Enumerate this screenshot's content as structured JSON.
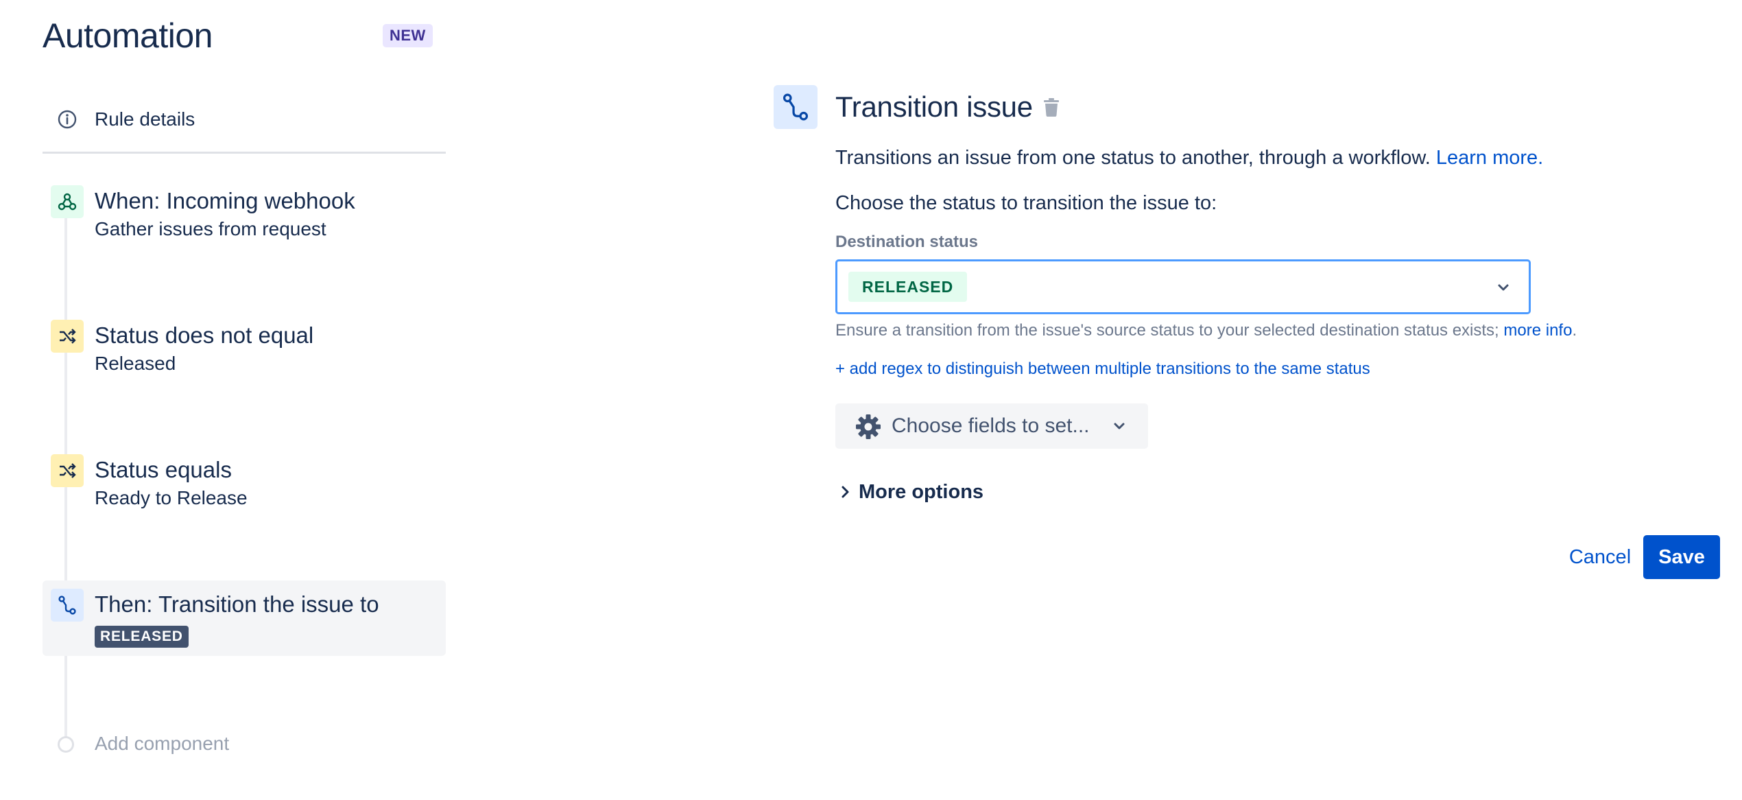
{
  "app": {
    "title": "Automation",
    "badge": "NEW"
  },
  "sidebar": {
    "rule_details": {
      "label": "Rule details",
      "icon": "info-icon"
    },
    "components": [
      {
        "title": "When: Incoming webhook",
        "subtitle": "Gather issues from request",
        "icon": "webhook-icon",
        "color": "#e3fcef"
      },
      {
        "title": "Status does not equal",
        "subtitle": "Released",
        "icon": "shuffle-icon",
        "color": "#fff0b3"
      },
      {
        "title": "Status equals",
        "subtitle": "Ready to Release",
        "icon": "shuffle-icon",
        "color": "#fff0b3"
      },
      {
        "title": "Then: Transition the issue to",
        "badge": "RELEASED",
        "icon": "transition-icon",
        "color": "#deebff",
        "selected": true
      }
    ],
    "add_component": "Add component"
  },
  "panel": {
    "title": "Transition issue",
    "description": "Transitions an issue from one status to another, through a workflow.",
    "learn_more": "Learn more.",
    "choose_label": "Choose the status to transition the issue to:",
    "destination_label": "Destination status",
    "destination_value": "RELEASED",
    "helper_text": "Ensure a transition from the issue's source status to your selected destination status exists;",
    "helper_link": "more info",
    "helper_end": ".",
    "regex_link": "+ add regex to distinguish between multiple transitions to the same status",
    "choose_fields": "Choose fields to set...",
    "more_options": "More options",
    "cancel": "Cancel",
    "save": "Save"
  },
  "colors": {
    "accent": "#0052cc",
    "focus_border": "#4c9aff",
    "released_green": "#006644",
    "text": "#172b4d"
  }
}
